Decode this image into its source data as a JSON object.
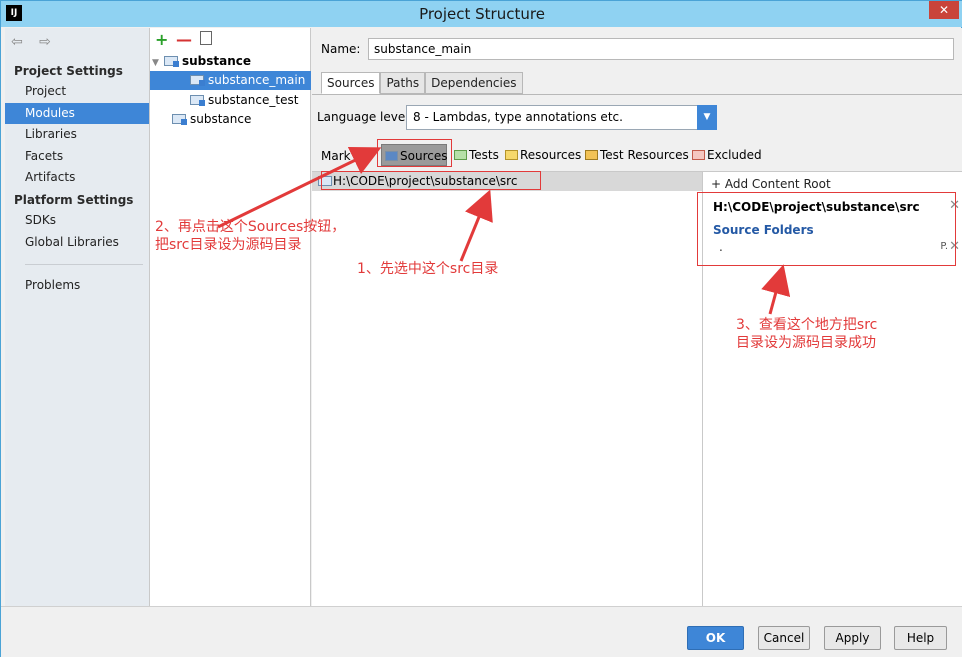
{
  "window": {
    "title": "Project Structure",
    "app_icon": "IJ",
    "close_glyph": "✕"
  },
  "nav": {
    "arrows": "⇦ ⇨",
    "project_settings": "Project Settings",
    "items_top": [
      "Project",
      "Modules",
      "Libraries",
      "Facets",
      "Artifacts"
    ],
    "platform_settings": "Platform Settings",
    "items_platform": [
      "SDKs",
      "Global Libraries"
    ],
    "problems": "Problems"
  },
  "tree": {
    "add": "+",
    "remove": "—",
    "root": "substance",
    "children": [
      "substance_main",
      "substance_test"
    ],
    "second_root": "substance"
  },
  "module": {
    "name_label": "Name:",
    "name_value": "substance_main",
    "tabs": [
      "Sources",
      "Paths",
      "Dependencies"
    ],
    "lang_label": "Language level:",
    "lang_value": "8 - Lambdas, type annotations etc.",
    "mark_label": "Mark as:",
    "mark_buttons": [
      "Sources",
      "Tests",
      "Resources",
      "Test Resources",
      "Excluded"
    ],
    "src_path": "H:\\CODE\\project\\substance\\src"
  },
  "content_root": {
    "add_label": "+ Add Content Root",
    "path": "H:\\CODE\\project\\substance\\src",
    "source_folders": "Source Folders",
    "folder_entry": ".",
    "p_glyph": "P.",
    "close_glyph": "✕"
  },
  "buttons": {
    "ok": "OK",
    "cancel": "Cancel",
    "apply": "Apply",
    "help": "Help"
  },
  "annotations": {
    "step1": "1、先选中这个src目录",
    "step2_line1": "2、再点击这个Sources按钮，",
    "step2_line2": "把src目录设为源码目录",
    "step3_line1": "3、查看这个地方把src",
    "step3_line2": "目录设为源码目录成功"
  },
  "colors": {
    "accent": "#3e86d7",
    "annotation": "#e23a3a"
  }
}
